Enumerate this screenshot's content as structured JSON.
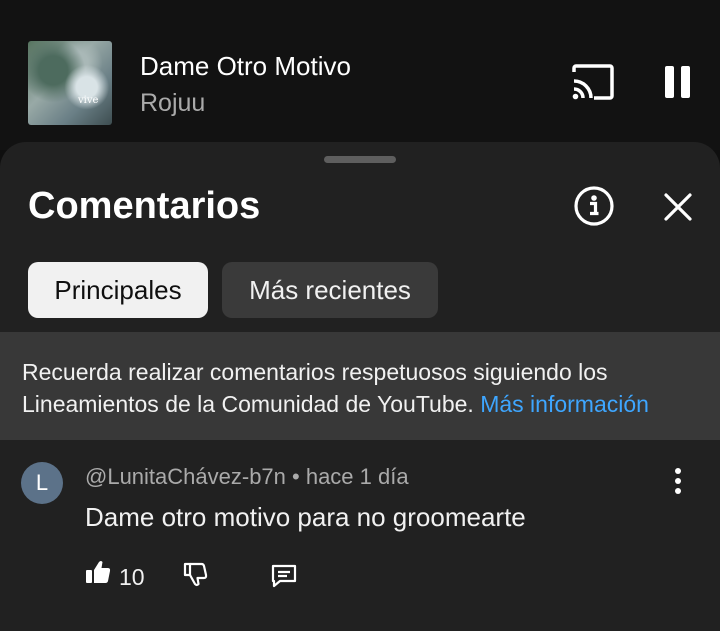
{
  "miniplayer": {
    "title": "Dame Otro Motivo",
    "artist": "Rojuu",
    "thumbnail_tag": "vive",
    "cast_icon": "cast-icon",
    "pause_icon": "pause-icon"
  },
  "comments_sheet": {
    "title": "Comentarios",
    "info_icon": "info-icon",
    "close_icon": "close-icon",
    "chips": [
      {
        "label": "Principales",
        "selected": true
      },
      {
        "label": "Más recientes",
        "selected": false
      }
    ],
    "notice": {
      "text": "Recuerda realizar comentarios respetuosos siguiendo los Lineamientos de la Comunidad de YouTube. ",
      "link_text": "Más información"
    }
  },
  "comment": {
    "avatar_letter": "L",
    "meta": "@LunitaChávez-b7n • hace 1 día",
    "text": "Dame otro motivo para no groomearte",
    "like_count": "10"
  },
  "colors": {
    "background": "#0f0f0f",
    "sheet": "#212121",
    "notice": "#383838",
    "link": "#3ea6ff",
    "avatar": "#5c7289"
  }
}
